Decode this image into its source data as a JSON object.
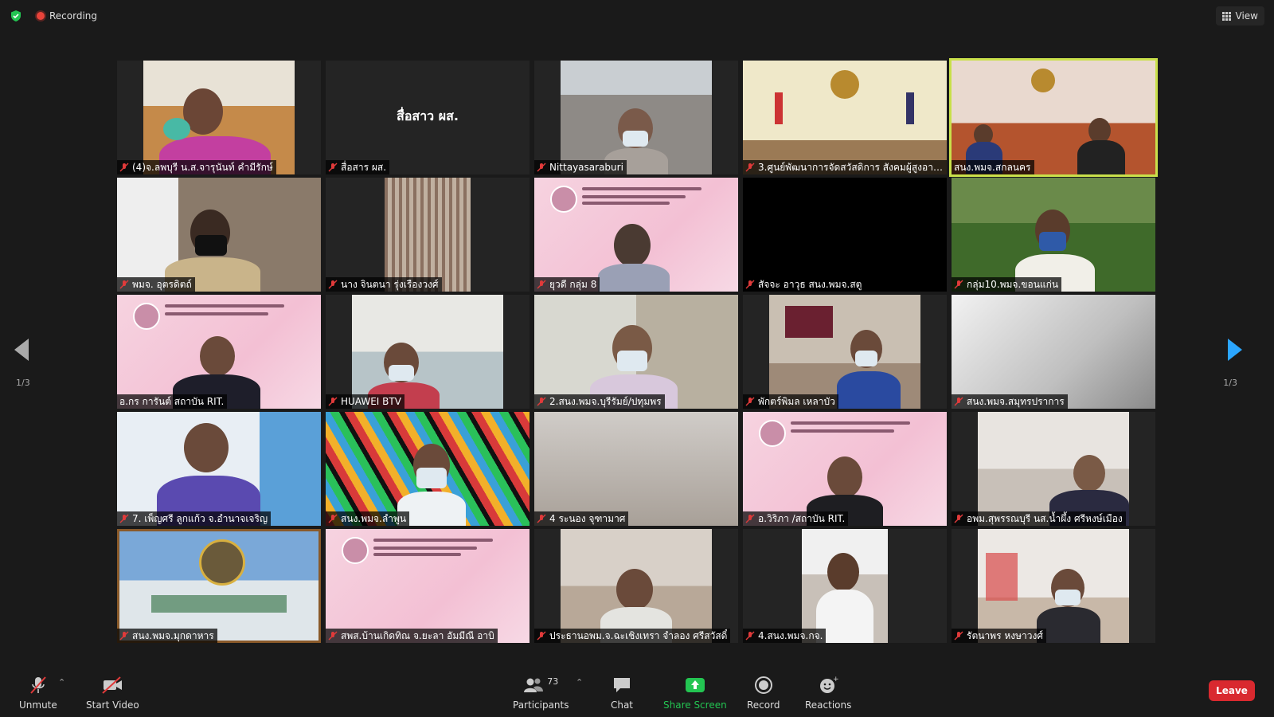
{
  "top": {
    "recording": "Recording",
    "view": "View"
  },
  "pager": {
    "left": "1/3",
    "right": "1/3"
  },
  "tiles": [
    {
      "name": "(4)จ.ลพบุรี น.ส.จารุนันท์ คำมีรักษ์"
    },
    {
      "name": "สื่อสาร ผส.",
      "big": "สื่อสาว ผส."
    },
    {
      "name": "Nittayasaraburi"
    },
    {
      "name": "3.ศูนย์พัฒนาการจัดสวัสดิการ สังคมผู้สูงอายุ..."
    },
    {
      "name": "สนง.พมจ.สกลนคร"
    },
    {
      "name": "พมจ. อุตรดิตถ์"
    },
    {
      "name": "นาง จินตนา รุ่งเรืองวงศ์"
    },
    {
      "name": "ยุวดี กลุ่ม 8"
    },
    {
      "name": "สัจจะ อาวุธ สนง.พมจ.สตู"
    },
    {
      "name": "กลุ่ม10.พมจ.ขอนแก่น"
    },
    {
      "name": "อ.กร  การันต์ สถาบัน RIT."
    },
    {
      "name": "HUAWEI BTV"
    },
    {
      "name": "2.สนง.พมจ.บุรีรัมย์/ปทุมพร"
    },
    {
      "name": "พักตร์พิมล เหลาบัว"
    },
    {
      "name": "สนง.พมจ.สมุทรปราการ"
    },
    {
      "name": "7. เพ็ญศรี ลูกแก้ว จ.อำนาจเจริญ"
    },
    {
      "name": "สนง.พมจ.ลำพูน"
    },
    {
      "name": "4 ระนอง จุฑามาศ"
    },
    {
      "name": "อ.วิริภา /สถาบัน RIT."
    },
    {
      "name": "อพม.สุพรรณบุรี นส.น้ำผึ้ง  ศรีหงษ์เมือง"
    },
    {
      "name": "สนง.พมจ.มุกดาหาร"
    },
    {
      "name": "สพส.บ้านเกิดทิณ จ.ยะลา อัมมีณี อาบิ"
    },
    {
      "name": "ประธานอพม.จ.ฉะเชิงเทรา จำลอง ศรีสวัสดิ์"
    },
    {
      "name": "4.สนง.พมจ.กจ."
    },
    {
      "name": "รัตนาพร หงษาวงศ์"
    }
  ],
  "toolbar": {
    "unmute": "Unmute",
    "start_video": "Start Video",
    "participants": "Participants",
    "participants_count": "73",
    "chat": "Chat",
    "share_screen": "Share Screen",
    "record": "Record",
    "reactions": "Reactions",
    "leave": "Leave"
  },
  "colors": {
    "accent_active": "#c9e04b",
    "share": "#23c552",
    "leave": "#d9292f",
    "nav": "#2ba6ff",
    "recording": "#e8433a"
  }
}
